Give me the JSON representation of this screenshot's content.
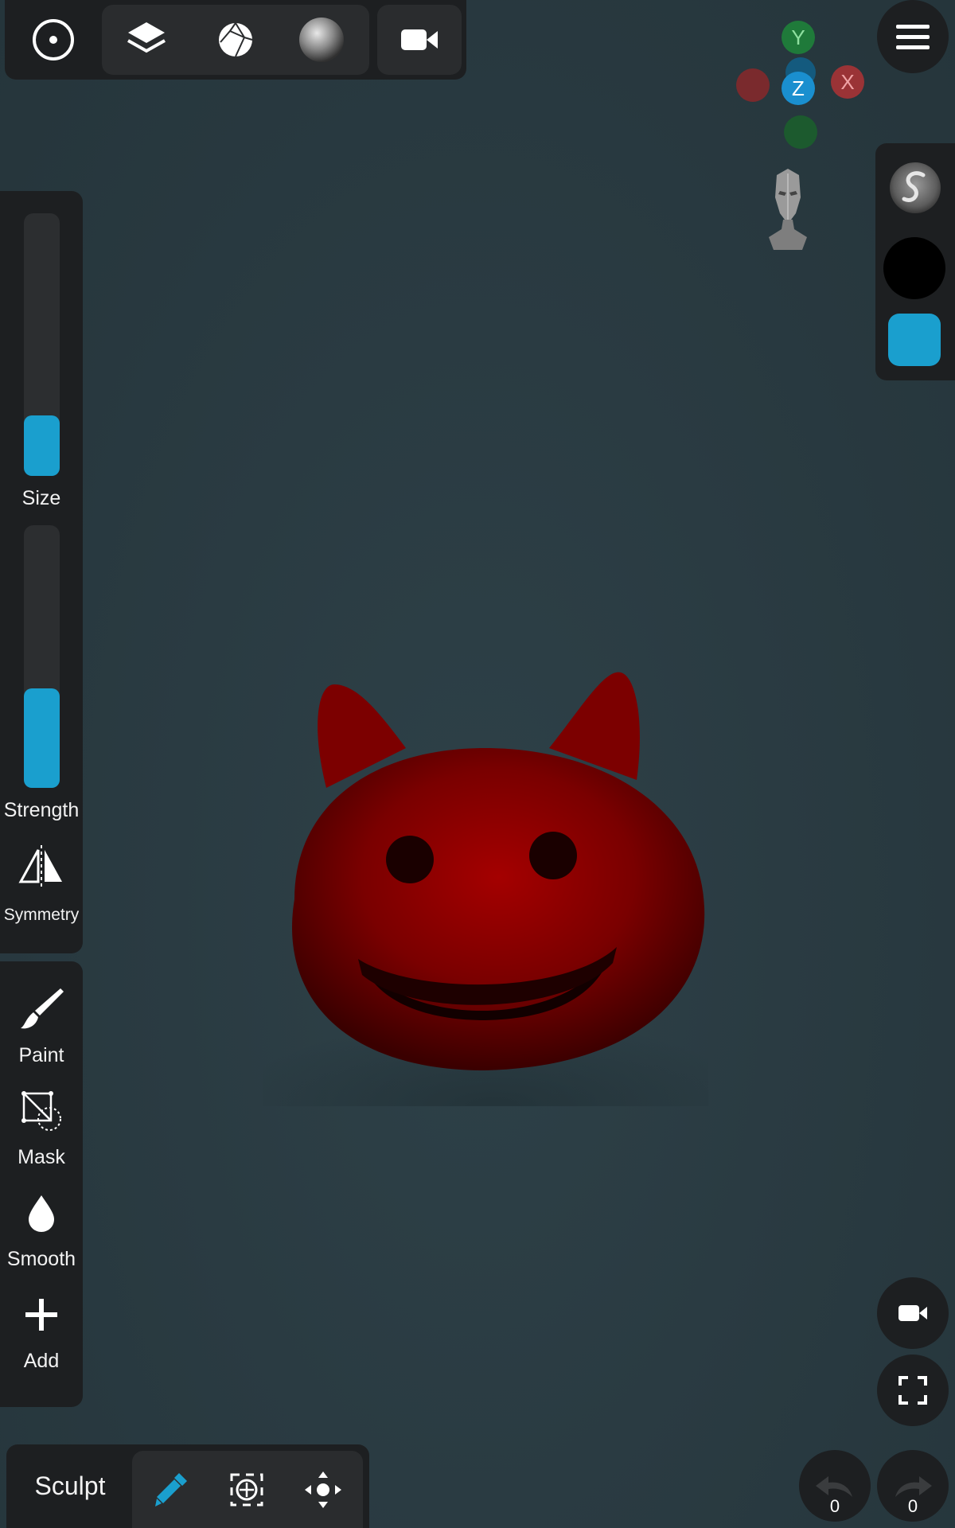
{
  "app": {
    "mode_label": "Sculpt"
  },
  "gizmo": {
    "y_label": "Y",
    "z_label": "Z",
    "x_label": "X"
  },
  "sliders": {
    "size": {
      "label": "Size",
      "value": 0.23
    },
    "strength": {
      "label": "Strength",
      "value": 0.38
    }
  },
  "left_tools": {
    "symmetry_label": "Symmetry"
  },
  "tools": [
    {
      "label": "Paint",
      "icon": "brush-icon"
    },
    {
      "label": "Mask",
      "icon": "mask-icon"
    },
    {
      "label": "Smooth",
      "icon": "drop-icon"
    },
    {
      "label": "Add",
      "icon": "plus-icon"
    }
  ],
  "history": {
    "undo_count": "0",
    "redo_count": "0"
  },
  "colors": {
    "accent": "#1a9fce",
    "model": "#8b0000",
    "panel": "#1d1f21",
    "axis_x": "#c0393b",
    "axis_y": "#1f7a3a",
    "axis_z": "#1a8fcf"
  }
}
